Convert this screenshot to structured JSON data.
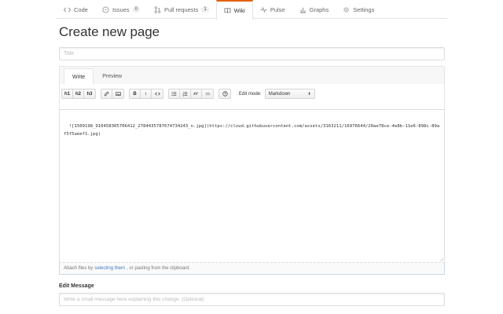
{
  "repo_nav": {
    "tabs": [
      {
        "label": "Code",
        "icon": "code-icon"
      },
      {
        "label": "Issues",
        "icon": "issue-icon",
        "count": "0"
      },
      {
        "label": "Pull requests",
        "icon": "pull-request-icon",
        "count": "1"
      },
      {
        "label": "Wiki",
        "icon": "book-icon",
        "selected": true
      },
      {
        "label": "Pulse",
        "icon": "pulse-icon"
      },
      {
        "label": "Graphs",
        "icon": "graph-icon"
      },
      {
        "label": "Settings",
        "icon": "gear-icon"
      }
    ]
  },
  "page": {
    "title": "Create new page",
    "title_placeholder": "Title"
  },
  "editor": {
    "tabs": [
      "Write",
      "Preview"
    ],
    "toolbar": {
      "headings": [
        "h1",
        "h2",
        "h3"
      ],
      "bold": "B",
      "italic": "i",
      "edit_mode_label": "Edit mode:",
      "edit_mode_value": "Markdown"
    },
    "content": "![1509198_910458305706412_2784435787674734243_n.jpg](https://cloud.githubusercontent.com/assets/3163211/16976644/20ae78ce-4e8b-11e6-898c-89af5f5aeef1.jpg)",
    "attach": {
      "prefix": "Attach files by",
      "link": "selecting them",
      "suffix": ", or pasting from the clipboard."
    }
  },
  "edit_message": {
    "label": "Edit Message",
    "placeholder": "Write a small message here explaining this change. (Optional)"
  },
  "colors": {
    "accent_tab": "#e36209",
    "link": "#4078c0"
  }
}
